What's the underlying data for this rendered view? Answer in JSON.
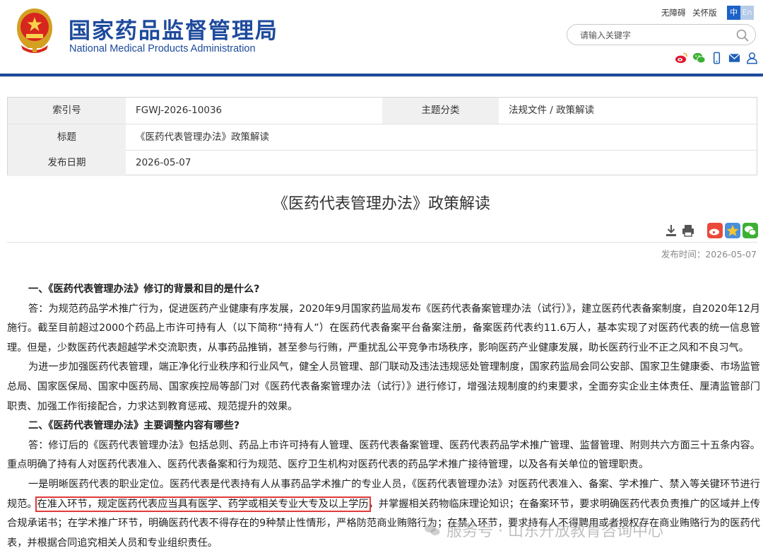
{
  "header": {
    "title_cn": "国家药品监督管理局",
    "title_en": "National Medical Products Administration",
    "accessibility_link": "无障碍",
    "care_version_link": "关怀版",
    "lang_zh": "中",
    "lang_en": "En",
    "search_placeholder": "请输入关键字",
    "brand_color": "#1d4a9c"
  },
  "meta": {
    "index_label": "索引号",
    "index_value": "FGWJ-2026-10036",
    "category_label": "主题分类",
    "category_value": "法规文件 / 政策解读",
    "title_label": "标题",
    "title_value": "《医药代表管理办法》政策解读",
    "date_label": "发布日期",
    "date_value": "2026-05-07"
  },
  "article": {
    "title": "《医药代表管理办法》政策解读",
    "published": "发布时间：2026-05-07",
    "q1": "一、《医药代表管理办法》修订的背景和目的是什么?",
    "a1_p1": "答：为规范药品学术推广行为，促进医药产业健康有序发展，2020年9月国家药监局发布《医药代表备案管理办法（试行）》，建立医药代表备案制度，自2020年12月施行。截至目前超过2000个药品上市许可持有人（以下简称“持有人”）在医药代表备案平台备案注册，备案医药代表约11.6万人，基本实现了对医药代表的统一信息管理。但是，少数医药代表超越学术交流职责，从事药品推销，甚至参与行贿，严重扰乱公平竞争市场秩序，影响医药产业健康发展，助长医药行业不正之风和不良习气。",
    "a1_p2": "为进一步加强医药代表管理，端正净化行业秩序和行业风气，健全人员管理、部门联动及违法违规惩处管理制度，国家药监局会同公安部、国家卫生健康委、市场监管总局、国家医保局、国家中医药局、国家疾控局等部门对《医药代表备案管理办法（试行）》进行修订，增强法规制度的约束要求，全面夯实企业主体责任、厘清监管部门职责、加强工作衔接配合，力求达到教育惩戒、规范提升的效果。",
    "q2": "二、《医药代表管理办法》主要调整内容有哪些?",
    "a2_p1": "答：修订后的《医药代表管理办法》包括总则、药品上市许可持有人管理、医药代表备案管理、医药代表药品学术推广管理、监督管理、附则共六方面三十五条内容。重点明确了持有人对医药代表准入、医药代表备案和行为规范、医疗卫生机构对医药代表的药品学术推广接待管理，以及各有关单位的管理职责。",
    "a2_p2_pre": "一是明晰医药代表的职业定位。医药代表是代表持有人从事药品学术推广的专业人员，《医药代表管理办法》对医药代表准入、备案、学术推广、禁入等关键环节进行规范。",
    "a2_p2_highlight": "在准入环节，规定医药代表应当具有医学、药学或相关专业大专及以上学历",
    "a2_p2_post": "，并掌握相关药物临床理论知识；在备案环节，要求明确医药代表负责推广的区域并上传合规承诺书；在学术推广环节，明确医药代表不得存在的9种禁止性情形，严格防范商业贿赂行为；在禁入环节，要求持有人不得聘用或者授权存在商业贿赂行为的医药代表，并根据合同追究相关人员和专业组织责任。",
    "highlight_color": "#e03b3b"
  },
  "watermark": {
    "text": "服务号 · 山东开放教育咨询中心"
  }
}
